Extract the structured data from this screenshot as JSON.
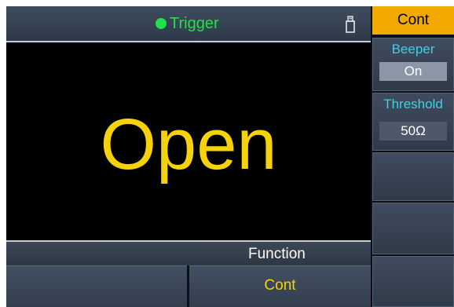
{
  "status_bar": {
    "title": "Trigger",
    "indicator_color": "#22e04a",
    "usb_icon": "usb-drive-icon"
  },
  "display": {
    "main_text": "Open",
    "text_color": "#f6d20a"
  },
  "function_bar": {
    "label": "Function"
  },
  "soft_keys": [
    {
      "label": ""
    },
    {
      "label": "Cont"
    }
  ],
  "menu": {
    "header": "Cont",
    "header_color": "#f2aa00",
    "items": [
      {
        "label": "Beeper",
        "value": "On"
      },
      {
        "label": "Threshold",
        "value": "50Ω"
      },
      {
        "label": "",
        "value": ""
      },
      {
        "label": "",
        "value": ""
      },
      {
        "label": "",
        "value": ""
      }
    ]
  }
}
